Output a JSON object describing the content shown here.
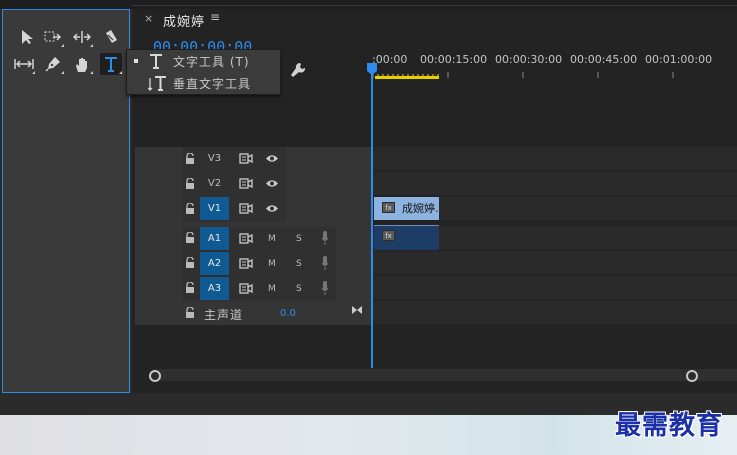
{
  "tools": {
    "row1": [
      "selection-tool",
      "track-select-tool",
      "ripple-edit-tool",
      "razor-tool"
    ],
    "row2": [
      "slip-tool",
      "pen-tool",
      "hand-tool",
      "type-tool"
    ]
  },
  "flyout": {
    "items": [
      {
        "label": "文字工具 (T)",
        "icon": "type-icon",
        "selected": true
      },
      {
        "label": "垂直文字工具",
        "icon": "vertical-type-icon",
        "selected": false
      }
    ]
  },
  "sequence": {
    "close_glyph": "×",
    "name": "成婉婷",
    "menu_glyph": "≡",
    "timecode": "00:00:00:00"
  },
  "ruler": {
    "labels": [
      ":00:00",
      "00:00:15:00",
      "00:00:30:00",
      "00:00:45:00",
      "00:01:00:00"
    ]
  },
  "tracks": {
    "video": [
      {
        "name": "V3",
        "targeted": false
      },
      {
        "name": "V2",
        "targeted": false
      },
      {
        "name": "V1",
        "targeted": true
      }
    ],
    "audio": [
      {
        "name": "A1",
        "m": "M",
        "s": "S"
      },
      {
        "name": "A2",
        "m": "M",
        "s": "S"
      },
      {
        "name": "A3",
        "m": "M",
        "s": "S"
      }
    ],
    "master": {
      "label": "主声道",
      "value": "0.0"
    }
  },
  "clips": {
    "video_clip_label": "成婉婷.",
    "fx_badge": "fx"
  },
  "watermark": "最需教育",
  "colors": {
    "accent": "#2d8ceb",
    "track_target": "#0f5a92",
    "video_clip": "#8db3e1",
    "audio_clip": "#1d3d66",
    "work_area": "#e8d100"
  }
}
